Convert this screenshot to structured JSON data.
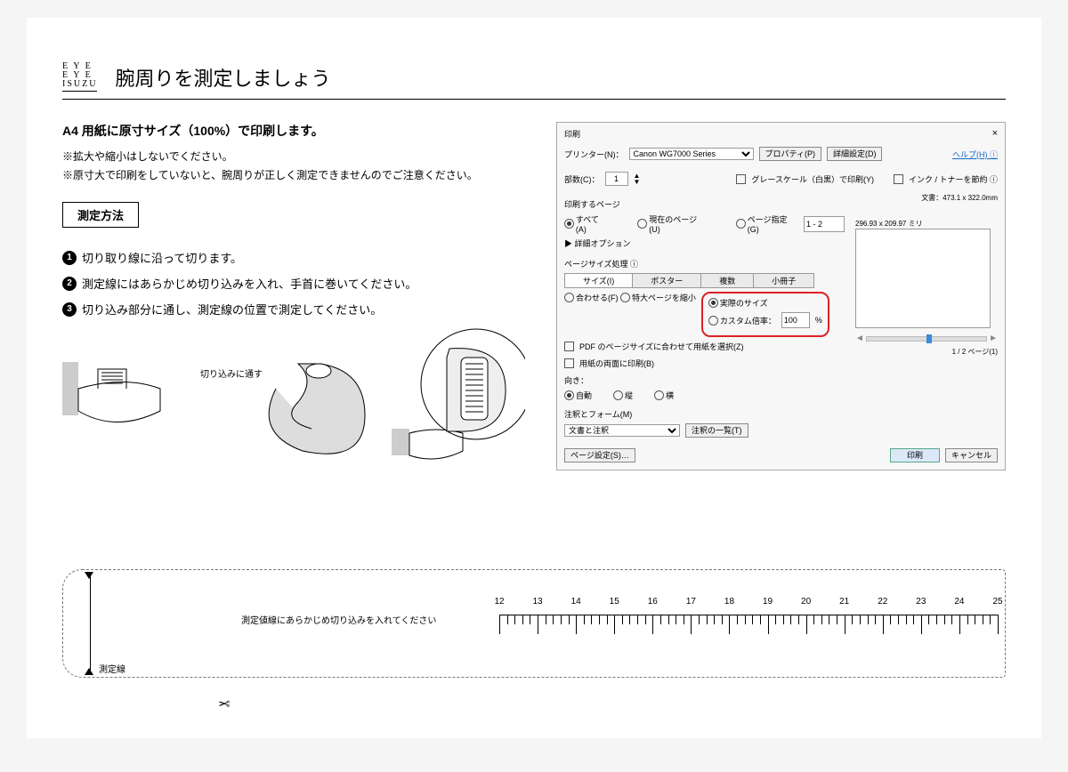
{
  "logo": {
    "l1": "E Y E",
    "l2": "E Y E",
    "l3": "ISUZU"
  },
  "title": "腕周りを測定しましょう",
  "instruction_bold": "A4 用紙に原寸サイズ（100%）で印刷します。",
  "notes": [
    "※拡大や縮小はしないでください。",
    "※原寸大で印刷をしていないと、腕周りが正しく測定できませんのでご注意ください。"
  ],
  "method_label": "測定方法",
  "steps": [
    "切り取り線に沿って切ります。",
    "測定線にはあらかじめ切り込みを入れ、手首に巻いてください。",
    "切り込み部分に通し、測定線の位置で測定してください。"
  ],
  "illus_label": "切り込みに通す",
  "ruler": {
    "start": 12,
    "end": 25,
    "note": "測定値線にあらかじめ切り込みを入れてください",
    "measure_label": "測定線",
    "scissors": "✂"
  },
  "print_dialog": {
    "title": "印刷",
    "close": "×",
    "printer_label": "プリンター(N)：",
    "printer_value": "Canon WG7000 Series",
    "properties": "プロパティ(P)",
    "advanced": "詳細設定(D)",
    "help": "ヘルプ(H) ⓘ",
    "copies_label": "部数(C)：",
    "copies_value": "1",
    "grayscale": "グレースケール（白黒）で印刷(Y)",
    "save_ink": "インク / トナーを節約 ⓘ",
    "pages_section": "印刷するページ",
    "all": "すべて(A)",
    "current": "現在のページ(U)",
    "range": "ページ指定(G)",
    "range_value": "1 - 2",
    "more_options": "▶ 詳細オプション",
    "doc_dims": "文書：473.1 x 322.0mm",
    "handling_section": "ページサイズ処理 ⓘ",
    "tabs": [
      "サイズ(I)",
      "ポスター",
      "複数",
      "小冊子"
    ],
    "fit": "合わせる(F)",
    "actual": "実際のサイズ",
    "shrink": "特大ページを縮小",
    "custom": "カスタム倍率：",
    "custom_value": "100",
    "percent": "%",
    "pdf_paper": "PDF のページサイズに合わせて用紙を選択(Z)",
    "both_sides": "用紙の両面に印刷(B)",
    "orientation_label": "向き：",
    "orient_auto": "自動",
    "orient_portrait": "縦",
    "orient_landscape": "横",
    "comments_section": "注釈とフォーム(M)",
    "comments_value": "文書と注釈",
    "comments_list": "注釈の一覧(T)",
    "preview_dims": "296.93 x 209.97 ミリ",
    "page_of": "1 / 2 ページ(1)",
    "page_setup": "ページ設定(S)…",
    "print": "印刷",
    "cancel": "キャンセル"
  }
}
